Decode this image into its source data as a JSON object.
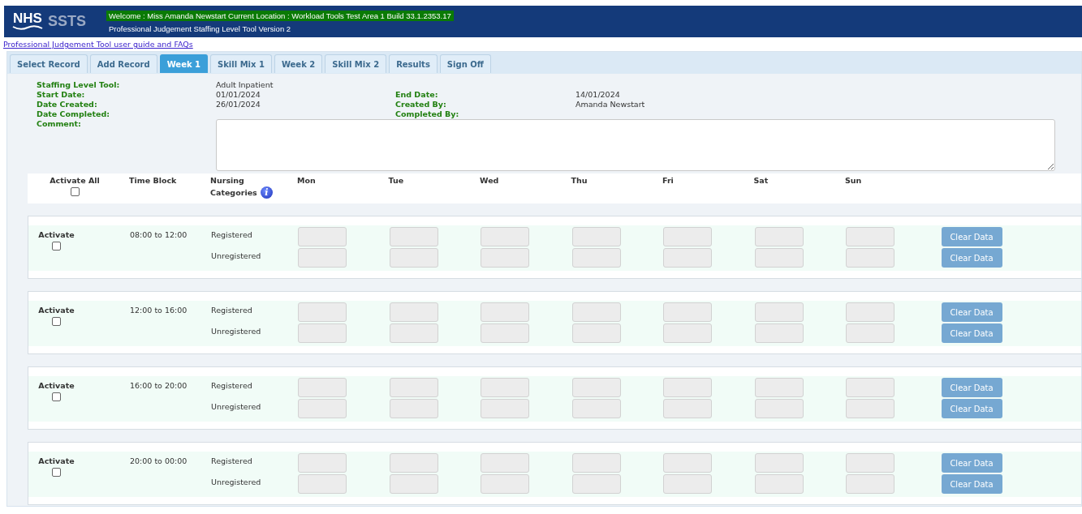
{
  "header": {
    "logo_left": "NHS",
    "logo_right": "SSTS",
    "welcome": "Welcome : Miss Amanda Newstart Current Location : Workload Tools Test Area 1 Build 33.1.2353.17",
    "subtitle": "Professional Judgement Staffing Level Tool Version 2"
  },
  "guide_link": "Professional Judgement Tool user guide and FAQs",
  "tabs": [
    {
      "label": "Select Record",
      "selected": false
    },
    {
      "label": "Add Record",
      "selected": false
    },
    {
      "label": "Week 1",
      "selected": true
    },
    {
      "label": "Skill Mix 1",
      "selected": false
    },
    {
      "label": "Week 2",
      "selected": false
    },
    {
      "label": "Skill Mix 2",
      "selected": false
    },
    {
      "label": "Results",
      "selected": false
    },
    {
      "label": "Sign Off",
      "selected": false
    }
  ],
  "details": {
    "staffing_level_tool": {
      "label": "Staffing Level Tool:",
      "value": "Adult Inpatient"
    },
    "start_date": {
      "label": "Start Date:",
      "value": "01/01/2024"
    },
    "end_date": {
      "label": "End Date:",
      "value": "14/01/2024"
    },
    "date_created": {
      "label": "Date Created:",
      "value": "26/01/2024"
    },
    "created_by": {
      "label": "Created By:",
      "value": "Amanda Newstart"
    },
    "date_completed": {
      "label": "Date Completed:"
    },
    "completed_by": {
      "label": "Completed By:"
    },
    "comment": {
      "label": "Comment:"
    }
  },
  "grid_header": {
    "activate_all": "Activate All",
    "activate_all_checked": false,
    "time_block": "Time Block",
    "nursing_categories_1": "Nursing",
    "nursing_categories_2": "Categories",
    "info": "i",
    "days": [
      "Mon",
      "Tue",
      "Wed",
      "Thu",
      "Fri",
      "Sat",
      "Sun"
    ]
  },
  "blocks": [
    {
      "activate": "Activate",
      "checked": false,
      "time": "08:00 to 12:00",
      "categories": [
        "Registered",
        "Unregistered"
      ],
      "clear": [
        "Clear Data",
        "Clear Data"
      ]
    },
    {
      "activate": "Activate",
      "checked": false,
      "time": "12:00 to 16:00",
      "categories": [
        "Registered",
        "Unregistered"
      ],
      "clear": [
        "Clear Data",
        "Clear Data"
      ]
    },
    {
      "activate": "Activate",
      "checked": false,
      "time": "16:00 to 20:00",
      "categories": [
        "Registered",
        "Unregistered"
      ],
      "clear": [
        "Clear Data",
        "Clear Data"
      ]
    },
    {
      "activate": "Activate",
      "checked": false,
      "time": "20:00 to 00:00",
      "categories": [
        "Registered",
        "Unregistered"
      ],
      "clear": [
        "Clear Data",
        "Clear Data"
      ]
    }
  ]
}
